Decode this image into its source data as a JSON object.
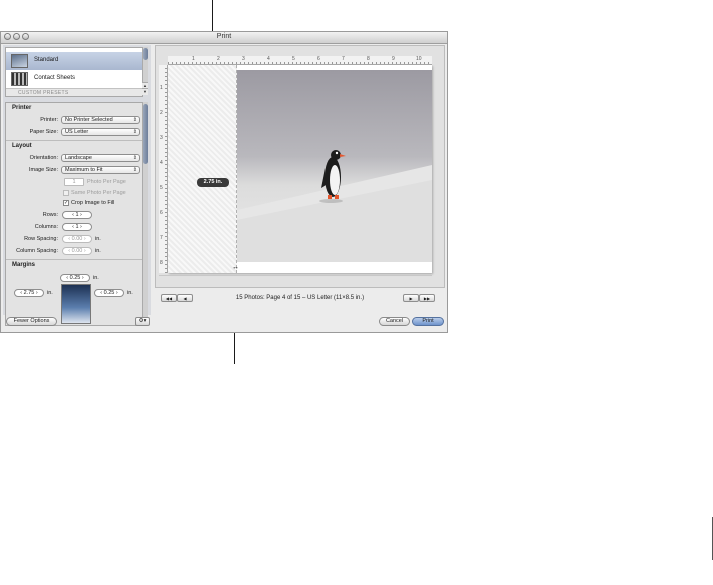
{
  "window": {
    "title": "Print"
  },
  "presets": {
    "items": [
      {
        "label": "Standard",
        "selected": true
      },
      {
        "label": "Contact Sheets",
        "selected": false
      }
    ],
    "custom_header": "CUSTOM PRESETS"
  },
  "printer": {
    "section_title": "Printer",
    "printer_label": "Printer:",
    "printer_value": "No Printer Selected",
    "paper_label": "Paper Size:",
    "paper_value": "US Letter"
  },
  "layout": {
    "section_title": "Layout",
    "orientation_label": "Orientation:",
    "orientation_value": "Landscape",
    "image_size_label": "Image Size:",
    "image_size_value": "Maximum to Fit",
    "photo_per_page_value": "1",
    "photo_per_page_label": "Photo Per Page",
    "same_photo_label": "Same Photo Per Page",
    "crop_label": "Crop Image to Fill",
    "rows_label": "Rows:",
    "rows_value": "1",
    "columns_label": "Columns:",
    "columns_value": "1",
    "row_spacing_label": "Row Spacing:",
    "row_spacing_value": "0.00",
    "column_spacing_label": "Column Spacing:",
    "column_spacing_value": "0.00",
    "unit": "in."
  },
  "margins": {
    "section_title": "Margins",
    "top_value": "0.25",
    "left_value": "2.75",
    "right_value": "0.25",
    "unit": "in."
  },
  "buttons": {
    "fewer_options": "Fewer Options",
    "gear": "⚙▾",
    "cancel": "Cancel",
    "print": "Print"
  },
  "ruler": {
    "ticks": [
      "1",
      "2",
      "3",
      "4",
      "5",
      "6",
      "7",
      "8",
      "9",
      "10"
    ],
    "vticks": [
      "1",
      "2",
      "3",
      "4",
      "5",
      "6",
      "7",
      "8"
    ]
  },
  "preview": {
    "tooltip": "2.75 in.",
    "status": "15 Photos: Page 4 of 15 – US Letter (11×8.5 in.)",
    "nav": {
      "first": "◀◀",
      "prev": "◀",
      "next": "▶",
      "last": "▶▶"
    }
  }
}
